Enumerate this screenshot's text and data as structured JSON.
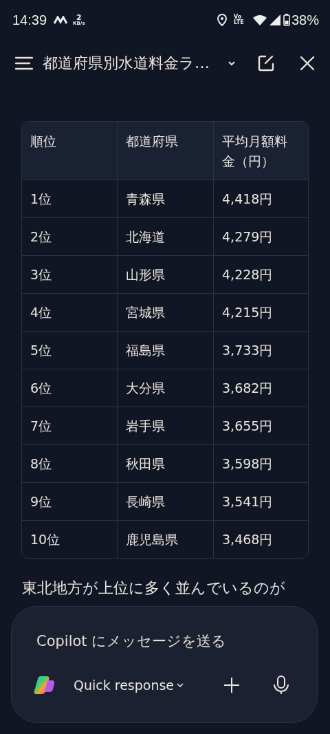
{
  "status_bar": {
    "time": "14:39",
    "speed_value": "2",
    "speed_unit": "KB/s",
    "network": "Vo LTE",
    "battery": "38%"
  },
  "header": {
    "title": "都道府県別水道料金ラ…"
  },
  "table": {
    "columns": [
      "順位",
      "都道府県",
      "平均月額料金（円）"
    ],
    "rows": [
      [
        "1位",
        "青森県",
        "4,418円"
      ],
      [
        "2位",
        "北海道",
        "4,279円"
      ],
      [
        "3位",
        "山形県",
        "4,228円"
      ],
      [
        "4位",
        "宮城県",
        "4,215円"
      ],
      [
        "5位",
        "福島県",
        "3,733円"
      ],
      [
        "6位",
        "大分県",
        "3,682円"
      ],
      [
        "7位",
        "岩手県",
        "3,655円"
      ],
      [
        "8位",
        "秋田県",
        "3,598円"
      ],
      [
        "9位",
        "長崎県",
        "3,541円"
      ],
      [
        "10位",
        "鹿児島県",
        "3,468円"
      ]
    ]
  },
  "paragraph": "東北地方が上位に多く並んでいるのが",
  "composer": {
    "placeholder": "Copilot にメッセージを送る",
    "mode": "Quick response"
  }
}
